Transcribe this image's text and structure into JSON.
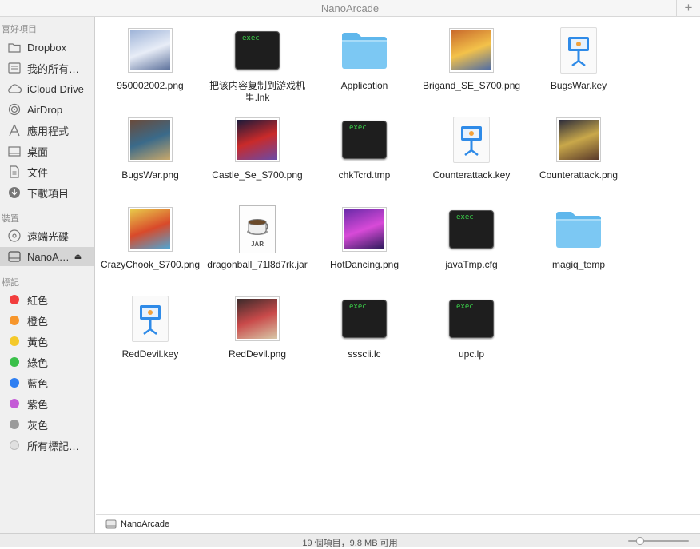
{
  "window": {
    "title": "NanoArcade",
    "add_tab": "+"
  },
  "sidebar": {
    "favorites_header": "喜好項目",
    "favorites": [
      {
        "label": "Dropbox",
        "icon": "folder-icon"
      },
      {
        "label": "我的所有…",
        "icon": "all-files-icon"
      },
      {
        "label": "iCloud Drive",
        "icon": "cloud-icon"
      },
      {
        "label": "AirDrop",
        "icon": "airdrop-icon"
      },
      {
        "label": "應用程式",
        "icon": "applications-icon"
      },
      {
        "label": "桌面",
        "icon": "desktop-icon"
      },
      {
        "label": "文件",
        "icon": "document-icon"
      },
      {
        "label": "下載項目",
        "icon": "download-icon"
      }
    ],
    "devices_header": "裝置",
    "devices": [
      {
        "label": "遠端光碟",
        "icon": "disc-icon"
      },
      {
        "label": "NanoA…",
        "icon": "drive-icon",
        "eject": "⏏"
      }
    ],
    "tags_header": "標記",
    "tags": [
      {
        "label": "紅色",
        "color": "#f23d3d"
      },
      {
        "label": "橙色",
        "color": "#f7962b"
      },
      {
        "label": "黃色",
        "color": "#f4c92a"
      },
      {
        "label": "綠色",
        "color": "#3ac04a"
      },
      {
        "label": "藍色",
        "color": "#2f7ff2"
      },
      {
        "label": "紫色",
        "color": "#c45bd6"
      },
      {
        "label": "灰色",
        "color": "#9b9b9b"
      },
      {
        "label": "所有標記…",
        "color": "#e0e0e0"
      }
    ]
  },
  "files": [
    {
      "name": "950002002.png",
      "kind": "image",
      "palette": [
        "#9fb4d8",
        "#e8edf7",
        "#5a6f9a"
      ]
    },
    {
      "name": "把该内容复制到游戏机里.lnk",
      "kind": "exec"
    },
    {
      "name": "Application",
      "kind": "folder"
    },
    {
      "name": "Brigand_SE_S700.png",
      "kind": "image",
      "palette": [
        "#c96a2c",
        "#f3c24a",
        "#4a6aa8"
      ]
    },
    {
      "name": "BugsWar.key",
      "kind": "keynote"
    },
    {
      "name": "BugsWar.png",
      "kind": "image",
      "palette": [
        "#6a4a3a",
        "#3a6a8a",
        "#c9a86a"
      ]
    },
    {
      "name": "Castle_Se_S700.png",
      "kind": "image",
      "palette": [
        "#1a1a3a",
        "#c92a2a",
        "#6a4aa8"
      ]
    },
    {
      "name": "chkTcrd.tmp",
      "kind": "exec"
    },
    {
      "name": "Counterattack.key",
      "kind": "keynote"
    },
    {
      "name": "Counterattack.png",
      "kind": "image",
      "palette": [
        "#2a2a3a",
        "#c9a84a",
        "#5a3a2a"
      ]
    },
    {
      "name": "CrazyChook_S700.png",
      "kind": "image",
      "palette": [
        "#e8c94a",
        "#d94a2a",
        "#4aa8d8"
      ]
    },
    {
      "name": "dragonball_71l8d7rk.jar",
      "kind": "jar",
      "tag": "JAR"
    },
    {
      "name": "HotDancing.png",
      "kind": "image",
      "palette": [
        "#6a2aa8",
        "#d84ad8",
        "#2a1a5a"
      ]
    },
    {
      "name": "javaTmp.cfg",
      "kind": "exec"
    },
    {
      "name": "magiq_temp",
      "kind": "folder"
    },
    {
      "name": "RedDevil.key",
      "kind": "keynote"
    },
    {
      "name": "RedDevil.png",
      "kind": "image",
      "palette": [
        "#3a2a2a",
        "#c94a4a",
        "#d8c8a8"
      ]
    },
    {
      "name": "ssscii.lc",
      "kind": "exec"
    },
    {
      "name": "upc.lp",
      "kind": "exec"
    }
  ],
  "exec_label": "exec",
  "pathbar": {
    "label": "NanoArcade"
  },
  "status": {
    "text": "19 個項目，9.8 MB 可用"
  }
}
